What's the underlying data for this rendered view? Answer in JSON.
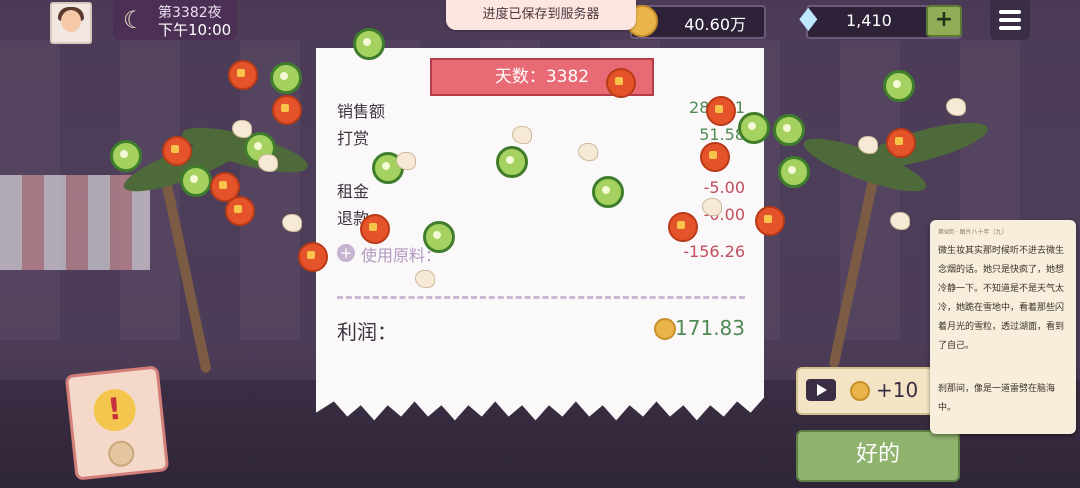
{
  "top_bar": {
    "night_title": "第3382夜",
    "time": "下午10:00",
    "toast": "进度已保存到服务器",
    "coins": "40.60万",
    "gems": "1,410",
    "add_label": "+"
  },
  "receipt": {
    "banner": "天数：3382",
    "rows": [
      {
        "label": "销售额",
        "value": "281.51"
      },
      {
        "label": "打赏",
        "value": "51.58"
      },
      {
        "label": "租金",
        "value": "-5.00"
      },
      {
        "label": "退款",
        "value": "-0.00"
      },
      {
        "label": "使用原料：",
        "value": "-156.26"
      }
    ],
    "profit_label": "利润：",
    "profit_value": "171.83"
  },
  "story": {
    "header": "第9回 · 图片八十年（九）",
    "p1": "微生妆其实那时候听不进去微生念烟的话。她只是快疯了，她想冷静一下。不知道是不是天气太冷，她跪在雪地中，看着那些闪着月光的雪粒，透过湖面，看到了自己。",
    "p2": "刹那间，像是一道雷劈在脑海中。"
  },
  "ad_reward": "+10",
  "ok_button": "好的",
  "colors": {
    "positive": "#4f8a54",
    "negative": "#c04e5c",
    "banner": "#e86a74",
    "ok": "#8fb26d"
  }
}
